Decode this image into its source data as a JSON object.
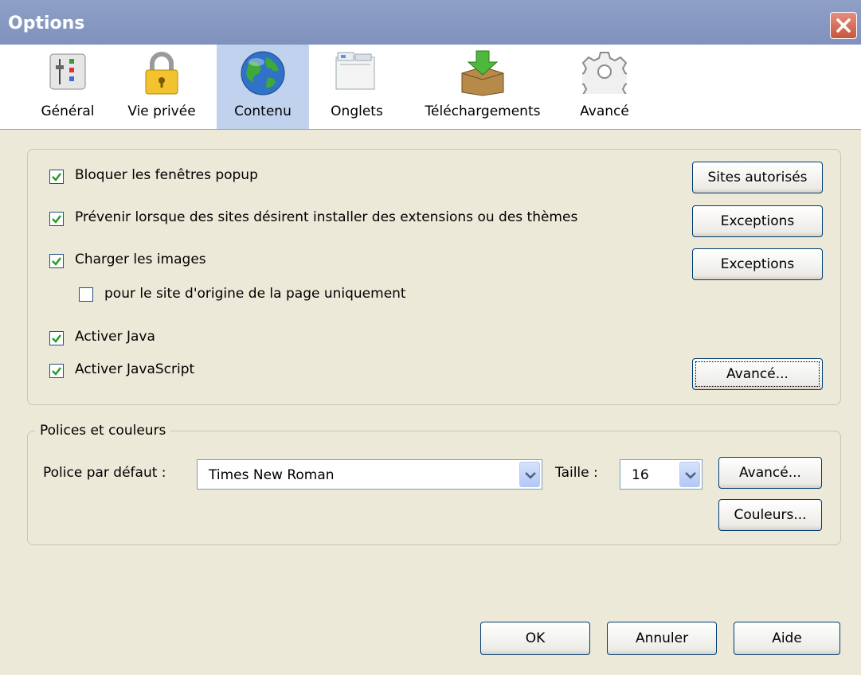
{
  "window": {
    "title": "Options"
  },
  "tabs": [
    {
      "label": "Général",
      "icon": "general-settings-icon"
    },
    {
      "label": "Vie privée",
      "icon": "padlock-icon"
    },
    {
      "label": "Contenu",
      "icon": "globe-icon",
      "selected": true
    },
    {
      "label": "Onglets",
      "icon": "tabs-icon"
    },
    {
      "label": "Téléchargements",
      "icon": "download-box-icon"
    },
    {
      "label": "Avancé",
      "icon": "gear-icon"
    }
  ],
  "content": {
    "block_popups": {
      "label": "Bloquer les fenêtres popup",
      "checked": true
    },
    "warn_install": {
      "label": "Prévenir lorsque des sites désirent installer des extensions ou des thèmes",
      "checked": true
    },
    "load_images": {
      "label": "Charger les images",
      "checked": true
    },
    "origin_only": {
      "label": "pour le site d'origine de la page uniquement",
      "checked": false
    },
    "enable_java": {
      "label": "Activer Java",
      "checked": true
    },
    "enable_js": {
      "label": "Activer JavaScript",
      "checked": true
    },
    "buttons": {
      "allowed_sites": "Sites autorisés",
      "exceptions1": "Exceptions",
      "exceptions2": "Exceptions",
      "advanced": "Avancé..."
    }
  },
  "fonts": {
    "legend": "Polices et couleurs",
    "default_font_label": "Police par défaut :",
    "default_font_value": "Times New Roman",
    "size_label": "Taille :",
    "size_value": "16",
    "advanced_button": "Avancé...",
    "colors_button": "Couleurs..."
  },
  "footer": {
    "ok": "OK",
    "cancel": "Annuler",
    "help": "Aide"
  }
}
